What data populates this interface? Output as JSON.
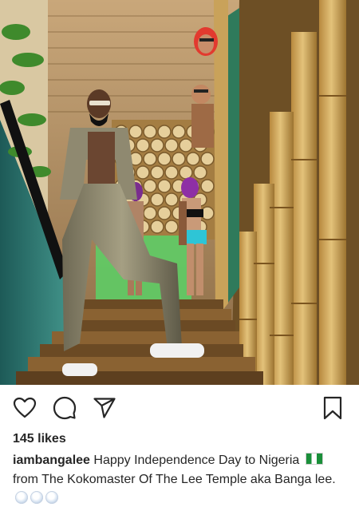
{
  "post": {
    "photo_description_icon": "post-photo",
    "actions": {
      "like_icon": "heart-outline-icon",
      "comment_icon": "comment-bubble-icon",
      "share_icon": "paper-plane-icon",
      "save_icon": "bookmark-outline-icon"
    },
    "likes_text": "145 likes",
    "caption": {
      "username": "iambangalee",
      "text_part1": " Happy Independence Day to Nigeria ",
      "flag_icon": "nigeria-flag-emoji",
      "text_part2": " from The Kokomaster Of The Lee Temple aka Banga lee. ",
      "trailing_icon": "light-bulb-emoji"
    }
  },
  "colors": {
    "text": "#262626",
    "background": "#ffffff"
  }
}
